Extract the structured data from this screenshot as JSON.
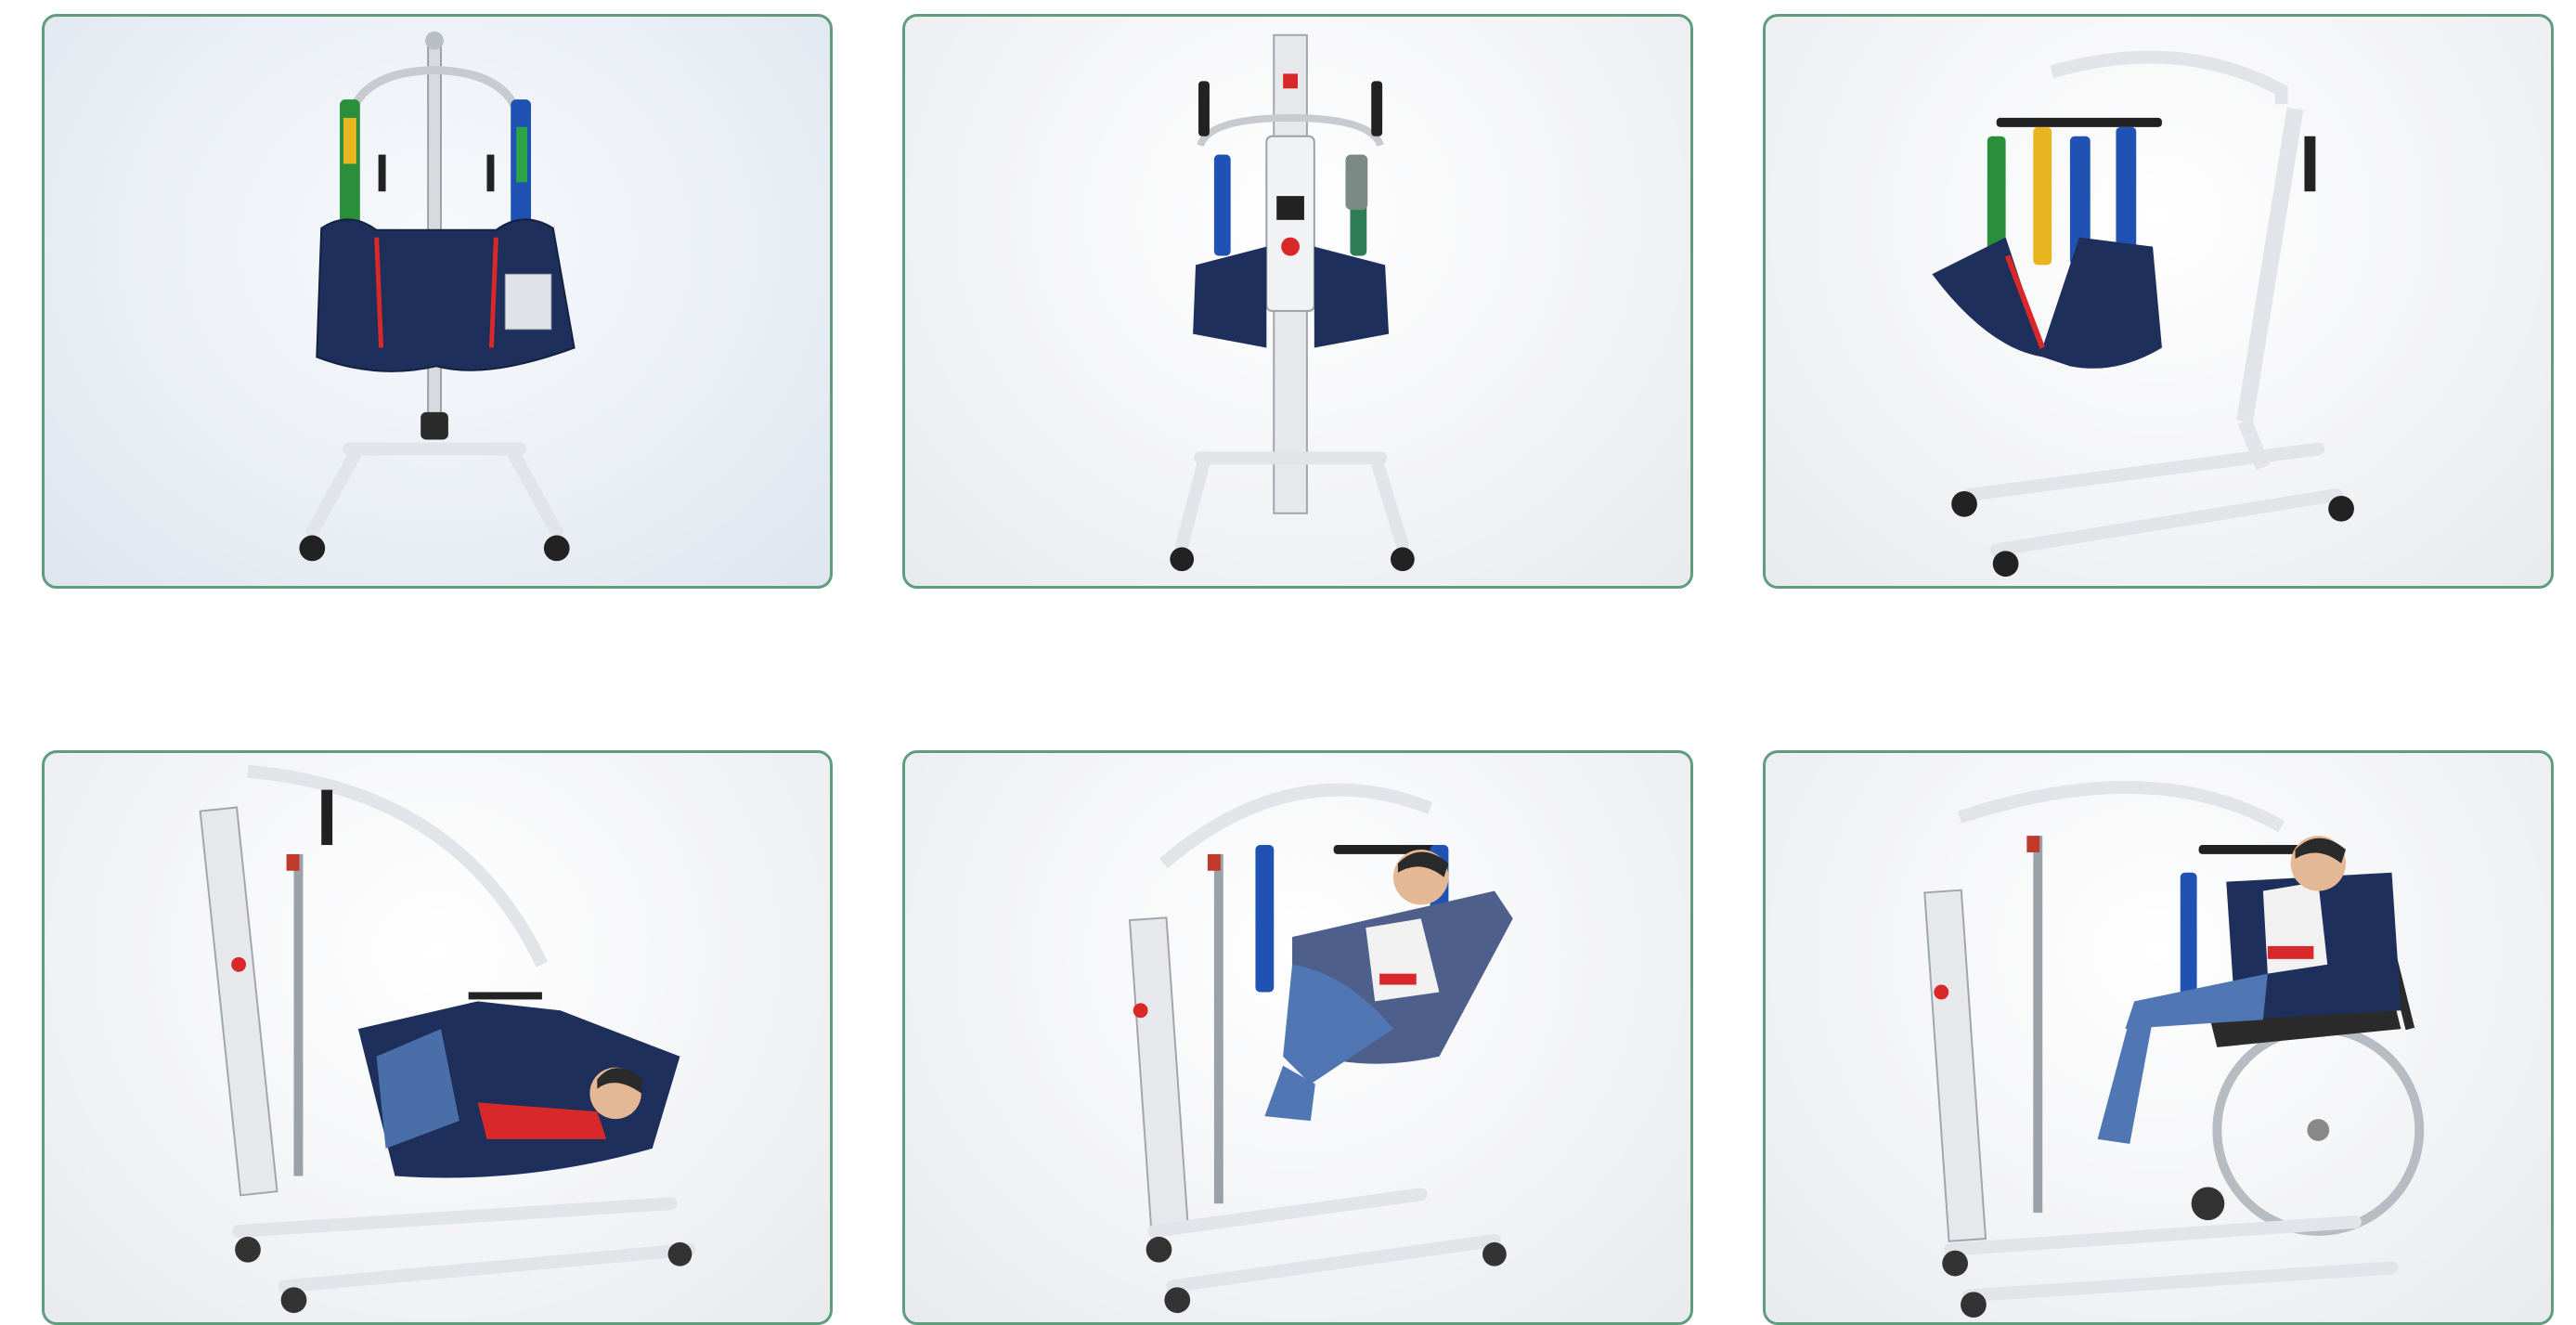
{
  "colors": {
    "frame": "#5e9e7f",
    "sling_navy": "#1e2f5c",
    "frame_white": "#eceef0",
    "accent_red": "#d8282a",
    "background": "#ffffff"
  },
  "gallery": {
    "items": [
      {
        "view": "front-sling"
      },
      {
        "view": "front-control-box"
      },
      {
        "view": "side-sling"
      },
      {
        "view": "patient-reclined"
      },
      {
        "view": "patient-lifted"
      },
      {
        "view": "patient-wheelchair"
      }
    ]
  }
}
